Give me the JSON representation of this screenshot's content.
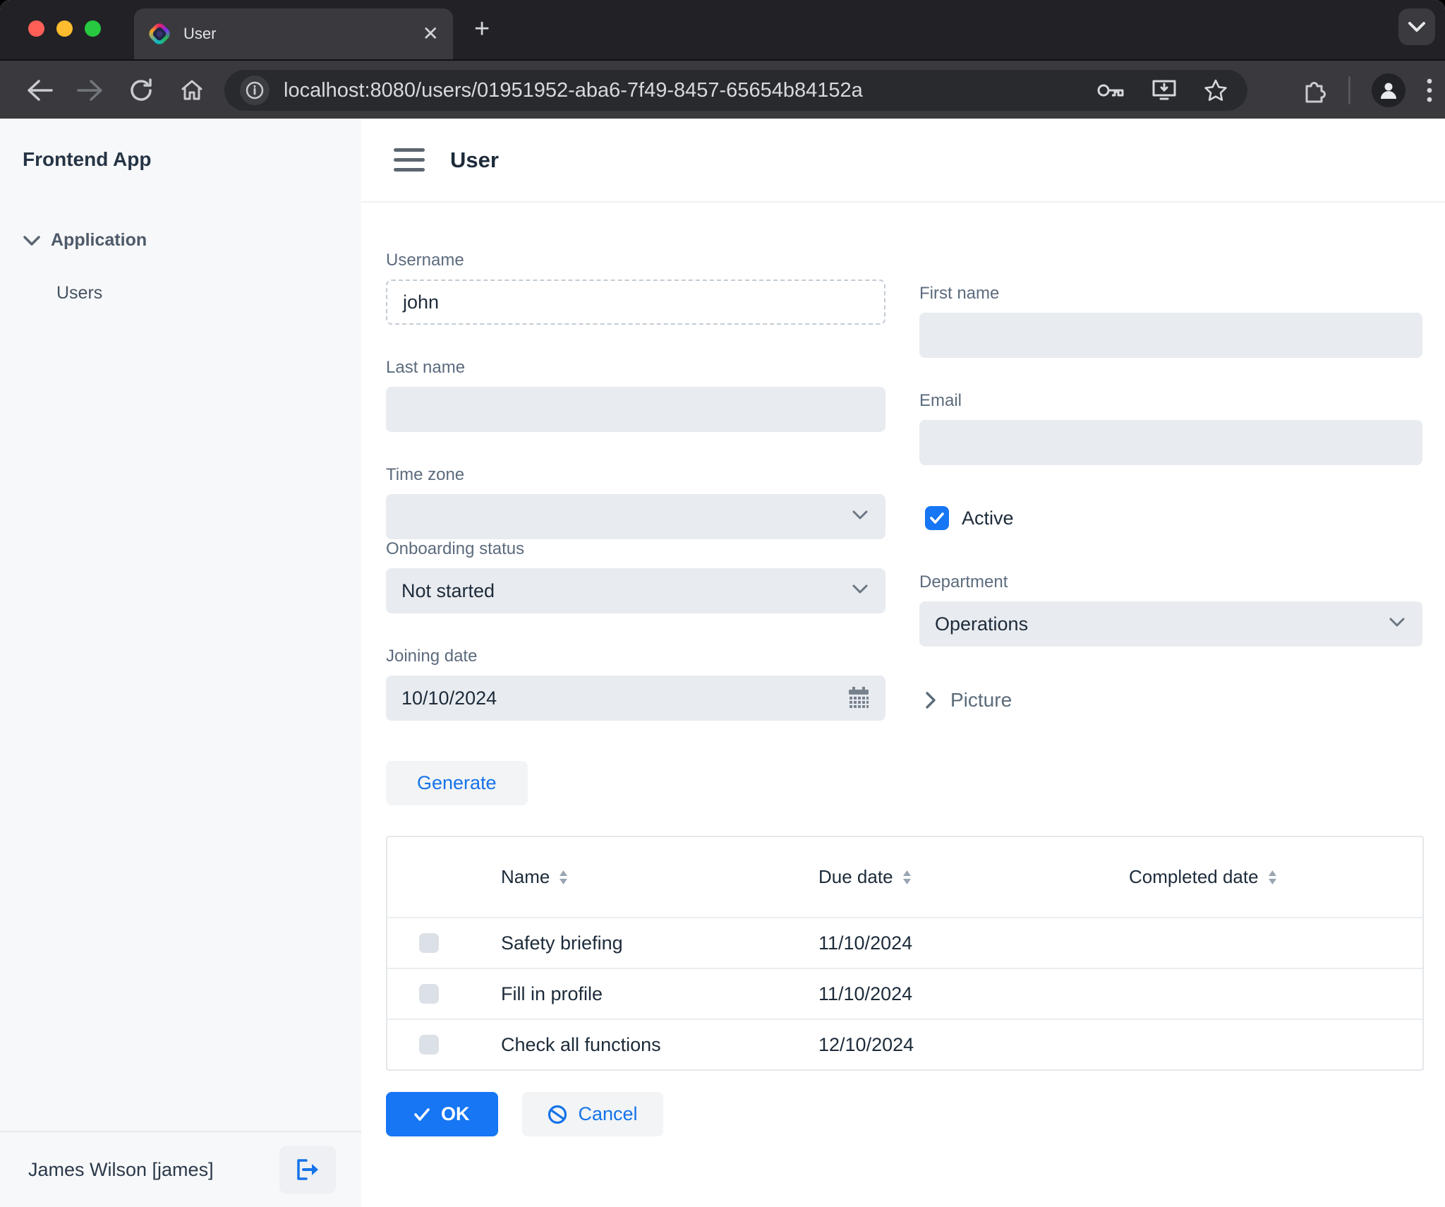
{
  "browser": {
    "tab_title": "User",
    "url": "localhost:8080/users/01951952-aba6-7f49-8457-65654b84152a"
  },
  "sidebar": {
    "app_title": "Frontend App",
    "section_application": "Application",
    "item_users": "Users",
    "footer_user": "James Wilson [james]"
  },
  "main": {
    "page_title": "User",
    "form": {
      "username": {
        "label": "Username",
        "value": "john"
      },
      "first_name": {
        "label": "First name",
        "value": ""
      },
      "last_name": {
        "label": "Last name",
        "value": ""
      },
      "email": {
        "label": "Email",
        "value": ""
      },
      "time_zone": {
        "label": "Time zone",
        "value": ""
      },
      "active": {
        "label": "Active",
        "checked": true
      },
      "onboarding_status": {
        "label": "Onboarding status",
        "value": "Not started"
      },
      "department": {
        "label": "Department",
        "value": "Operations"
      },
      "joining_date": {
        "label": "Joining date",
        "value": "10/10/2024"
      },
      "picture_section": {
        "label": "Picture",
        "collapsed": true
      },
      "generate_label": "Generate"
    },
    "table": {
      "columns": [
        "Name",
        "Due date",
        "Completed date"
      ],
      "rows": [
        {
          "checked": false,
          "name": "Safety briefing",
          "due_date": "11/10/2024",
          "completed_date": ""
        },
        {
          "checked": false,
          "name": "Fill in profile",
          "due_date": "11/10/2024",
          "completed_date": ""
        },
        {
          "checked": false,
          "name": "Check all functions",
          "due_date": "12/10/2024",
          "completed_date": ""
        }
      ]
    },
    "actions": {
      "ok": "OK",
      "cancel": "Cancel"
    }
  },
  "colors": {
    "primary": "#1676f3",
    "field_bg": "#e8ebef",
    "sidebar_bg": "#f7f8fa",
    "chrome_dark": "#222226",
    "chrome_toolbar": "#3a3a3e",
    "text_primary": "#1d2b3a",
    "text_label": "#5c6b7d"
  }
}
